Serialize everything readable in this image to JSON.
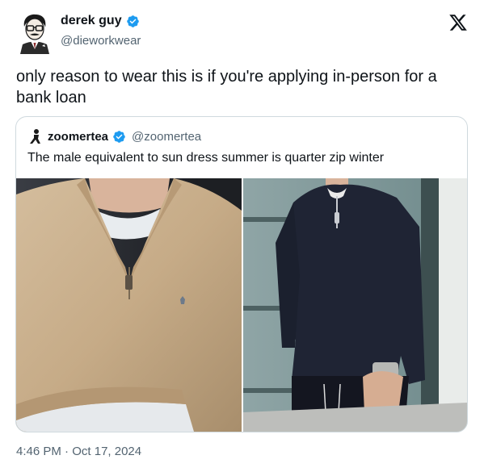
{
  "author": {
    "display_name": "derek guy",
    "handle": "@dieworkwear"
  },
  "tweet": {
    "text": "only reason to wear this is if you're applying in-person for a bank loan"
  },
  "quoted": {
    "display_name": "zoomertea",
    "handle": "@zoomertea",
    "text": "The male equivalent to sun dress summer is quarter zip winter"
  },
  "meta": {
    "time": "4:46 PM",
    "separator": " · ",
    "date": "Oct 17, 2024"
  },
  "colors": {
    "verified": "#1d9bf0",
    "text_primary": "#0f1419",
    "text_secondary": "#536471",
    "card_border": "#cfd9de",
    "sweater_tan": "#c9b08e",
    "sweater_navy": "#1f2434"
  },
  "icons": {
    "verified": "verified-badge-icon",
    "x_logo": "x-logo-icon"
  }
}
